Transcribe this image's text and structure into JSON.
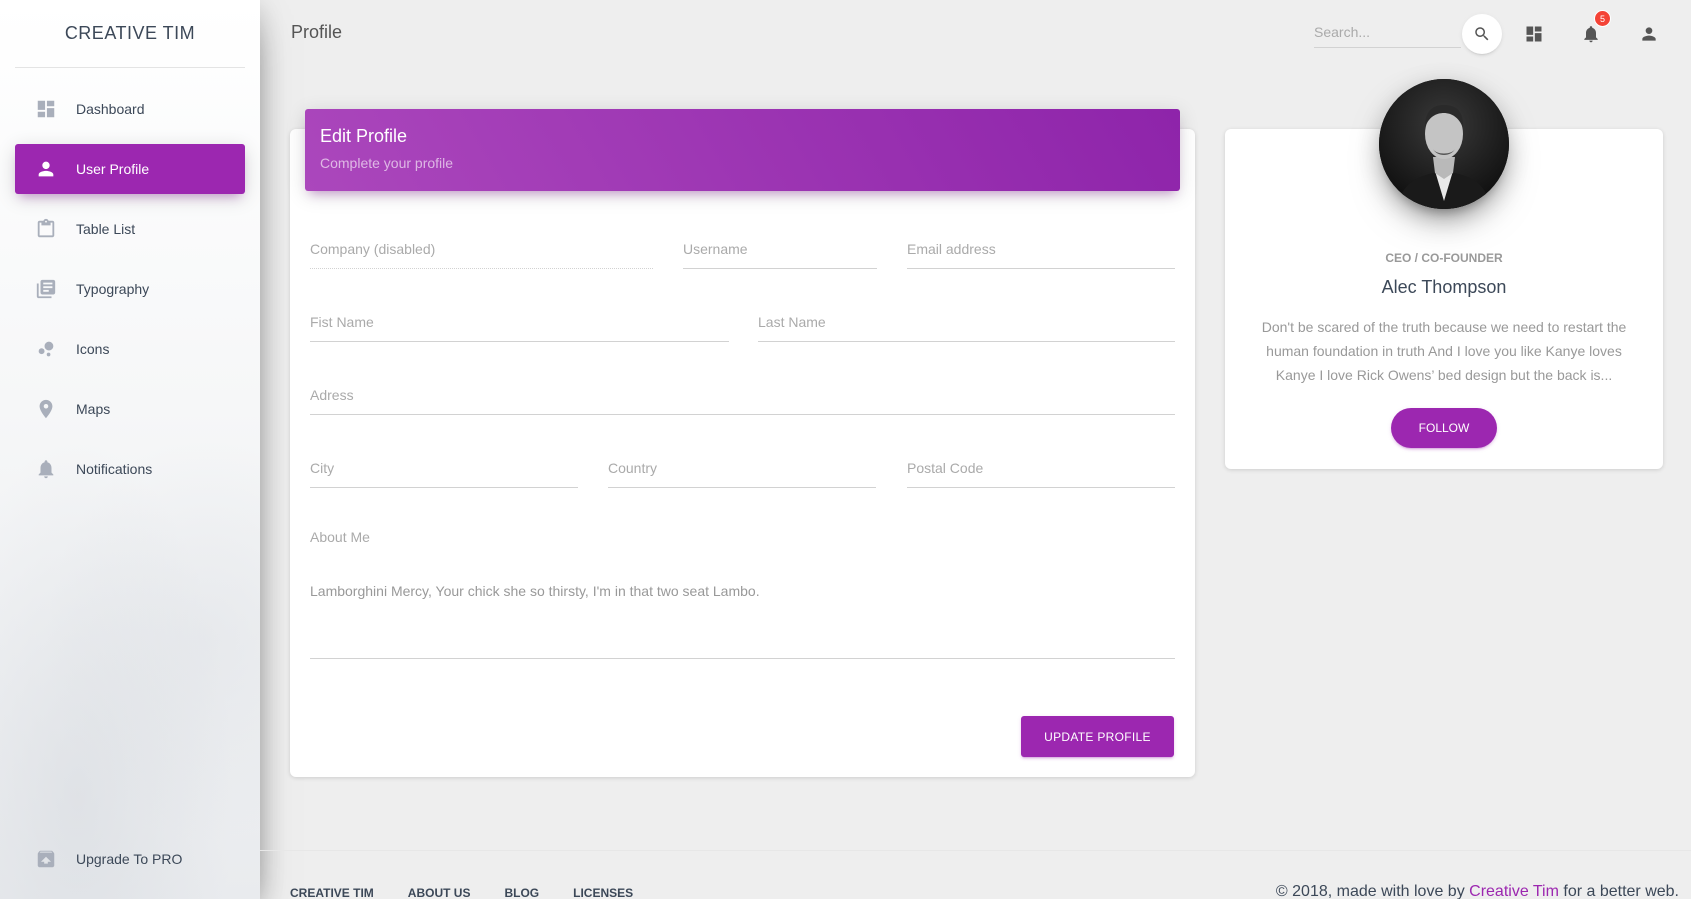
{
  "brand": "CREATIVE TIM",
  "sidebar": {
    "items": [
      {
        "label": "Dashboard",
        "icon": "dashboard-icon"
      },
      {
        "label": "User Profile",
        "icon": "person-icon",
        "active": true
      },
      {
        "label": "Table List",
        "icon": "clipboard-icon"
      },
      {
        "label": "Typography",
        "icon": "library-books-icon"
      },
      {
        "label": "Icons",
        "icon": "bubble-chart-icon"
      },
      {
        "label": "Maps",
        "icon": "location-pin-icon"
      },
      {
        "label": "Notifications",
        "icon": "bell-icon"
      }
    ],
    "upgrade": {
      "label": "Upgrade To PRO",
      "icon": "unarchive-icon"
    }
  },
  "topbar": {
    "title": "Profile",
    "search_placeholder": "Search...",
    "notification_count": "5"
  },
  "edit_profile": {
    "title": "Edit Profile",
    "subtitle": "Complete your profile",
    "fields": {
      "company": "Company (disabled)",
      "username": "Username",
      "email": "Email address",
      "first_name": "Fist Name",
      "last_name": "Last Name",
      "address": "Adress",
      "city": "City",
      "country": "Country",
      "postal_code": "Postal Code"
    },
    "about_label": "About Me",
    "about_text": "Lamborghini Mercy, Your chick she so thirsty, I'm in that two seat Lambo.",
    "update_button": "UPDATE PROFILE"
  },
  "profile_card": {
    "role": "CEO / CO-FOUNDER",
    "name": "Alec Thompson",
    "quote": "Don't be scared of the truth because we need to restart the human foundation in truth And I love you like Kanye loves Kanye I love Rick Owens’ bed design but the back is...",
    "follow_button": "FOLLOW"
  },
  "footer": {
    "links": [
      "CREATIVE TIM",
      "ABOUT US",
      "BLOG",
      "LICENSES"
    ],
    "copyright_prefix": "© 2018, made with love by ",
    "copyright_link": "Creative Tim",
    "copyright_suffix": " for a better web."
  },
  "colors": {
    "accent": "#9c27b0",
    "badge": "#f44336"
  }
}
